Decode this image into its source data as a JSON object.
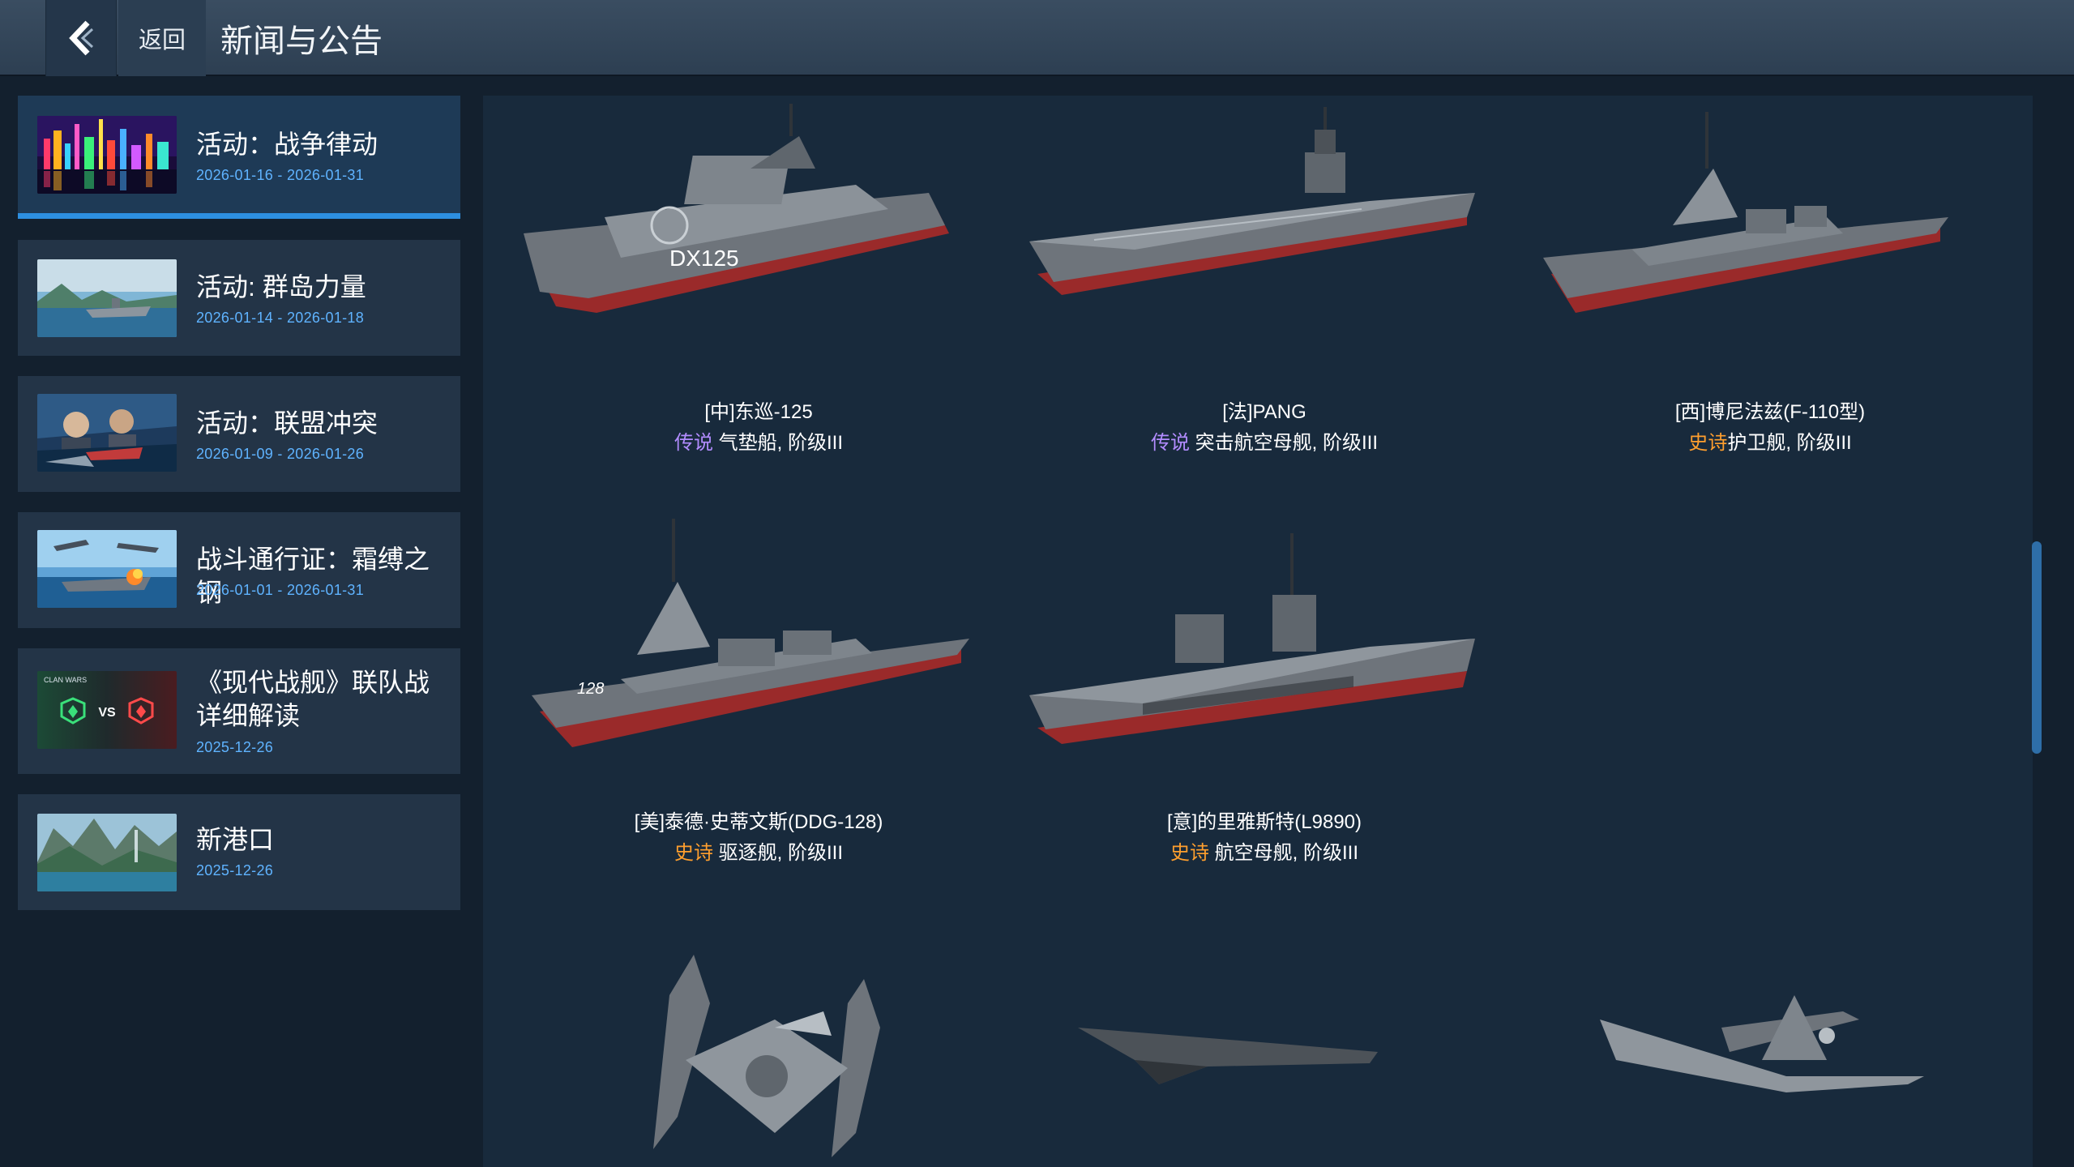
{
  "header": {
    "back_label": "返回",
    "title": "新闻与公告"
  },
  "sidebar": {
    "items": [
      {
        "title": "活动：战争律动",
        "date": "2026-01-16 - 2026-01-31",
        "active": true,
        "thumb": "city-night"
      },
      {
        "title": "活动: 群岛力量",
        "date": "2026-01-14 - 2026-01-18",
        "active": false,
        "thumb": "island-ship"
      },
      {
        "title": "活动：联盟冲突",
        "date": "2026-01-09 - 2026-01-26",
        "active": false,
        "thumb": "stormy-sea"
      },
      {
        "title": "战斗通行证：霜缚之钢",
        "date": "2026-01-01 - 2026-01-31",
        "active": false,
        "thumb": "naval-battle"
      },
      {
        "title": "《现代战舰》联队战详细解读",
        "date": "2025-12-26",
        "active": false,
        "thumb": "clan-wars",
        "thumb_text": "CLAN WARS",
        "thumb_vs": "VS"
      },
      {
        "title": "新港口",
        "date": "2025-12-26",
        "active": false,
        "thumb": "mountain-port"
      }
    ]
  },
  "vehicles": [
    {
      "name": "[中]东巡-125",
      "rarity": "传说",
      "desc": "气垫船, 阶级III",
      "hull_text": "DX125",
      "kind": "catamaran"
    },
    {
      "name": "[法]PANG",
      "rarity": "传说",
      "desc": "突击航空母舰, 阶级III",
      "kind": "carrier"
    },
    {
      "name": "[西]博尼法兹(F-110型)",
      "rarity": "史诗",
      "desc": "护卫舰, 阶级III",
      "kind": "frigate"
    },
    {
      "name": "[美]泰德·史蒂文斯(DDG-128)",
      "rarity": "史诗",
      "desc": "驱逐舰, 阶级III",
      "hull_text": "128",
      "kind": "destroyer"
    },
    {
      "name": "[意]的里雅斯特(L9890)",
      "rarity": "史诗",
      "desc": "航空母舰, 阶级III",
      "kind": "lhd"
    },
    {
      "kind": "mech-aircraft"
    },
    {
      "kind": "flying-wing"
    },
    {
      "kind": "drone"
    }
  ],
  "colors": {
    "legend": "#b28cff",
    "epic": "#ff9f2e",
    "accent": "#2d8fe0",
    "date": "#5fb3ff"
  },
  "icons": {
    "back": "chevron-left-icon"
  }
}
